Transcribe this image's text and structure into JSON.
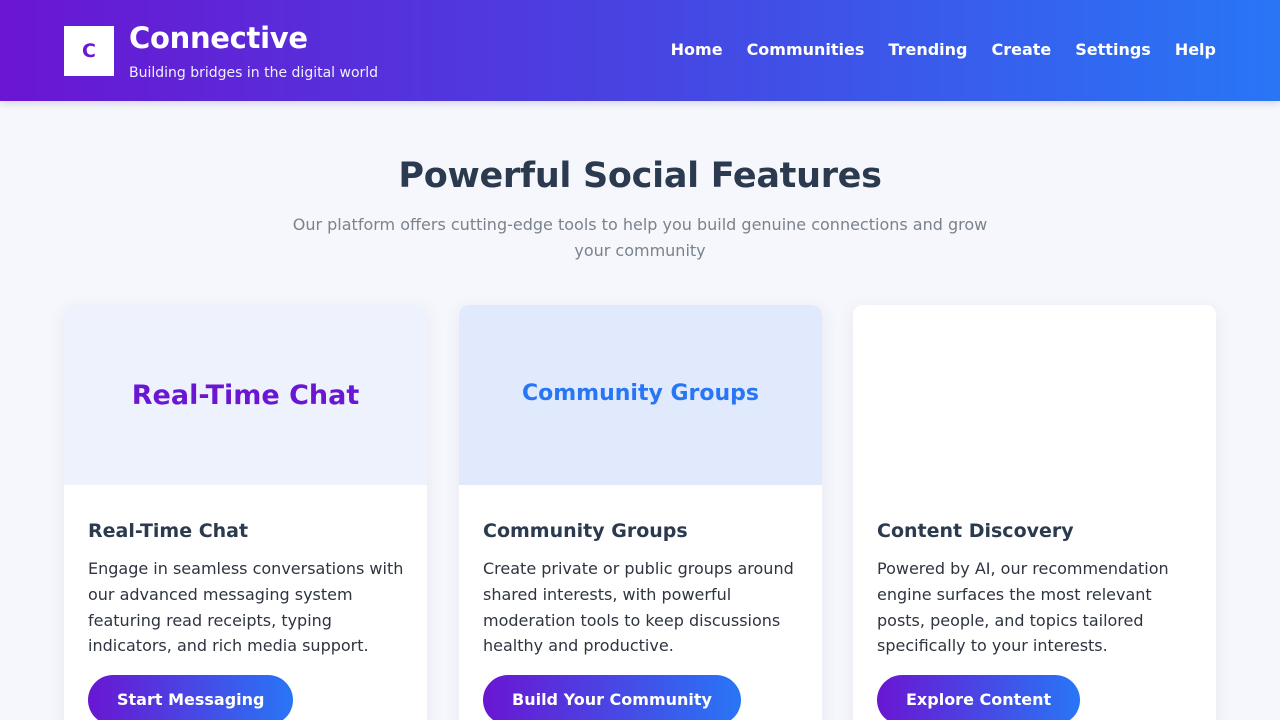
{
  "header": {
    "logo_letter": "C",
    "brand_name": "Connective",
    "tagline": "Building bridges in the digital world",
    "nav": [
      "Home",
      "Communities",
      "Trending",
      "Create",
      "Settings",
      "Help"
    ]
  },
  "features": {
    "title": "Powerful Social Features",
    "subtitle": "Our platform offers cutting-edge tools to help you build genuine connections and grow your community",
    "cards": [
      {
        "hero_label": "Real-Time Chat",
        "title": "Real-Time Chat",
        "text": "Engage in seamless conversations with our advanced messaging system featuring read receipts, typing indicators, and rich media support.",
        "button": "Start Messaging"
      },
      {
        "hero_label": "Community Groups",
        "title": "Community Groups",
        "text": "Create private or public groups around shared interests, with powerful moderation tools to keep discussions healthy and productive.",
        "button": "Build Your Community"
      },
      {
        "hero_label": "",
        "title": "Content Discovery",
        "text": "Powered by AI, our recommendation engine surfaces the most relevant posts, people, and topics tailored specifically to your interests.",
        "button": "Explore Content"
      }
    ]
  },
  "colors": {
    "brand_purple": "#6a16d2",
    "brand_blue": "#2876f6",
    "heading": "#2b3a4e"
  }
}
